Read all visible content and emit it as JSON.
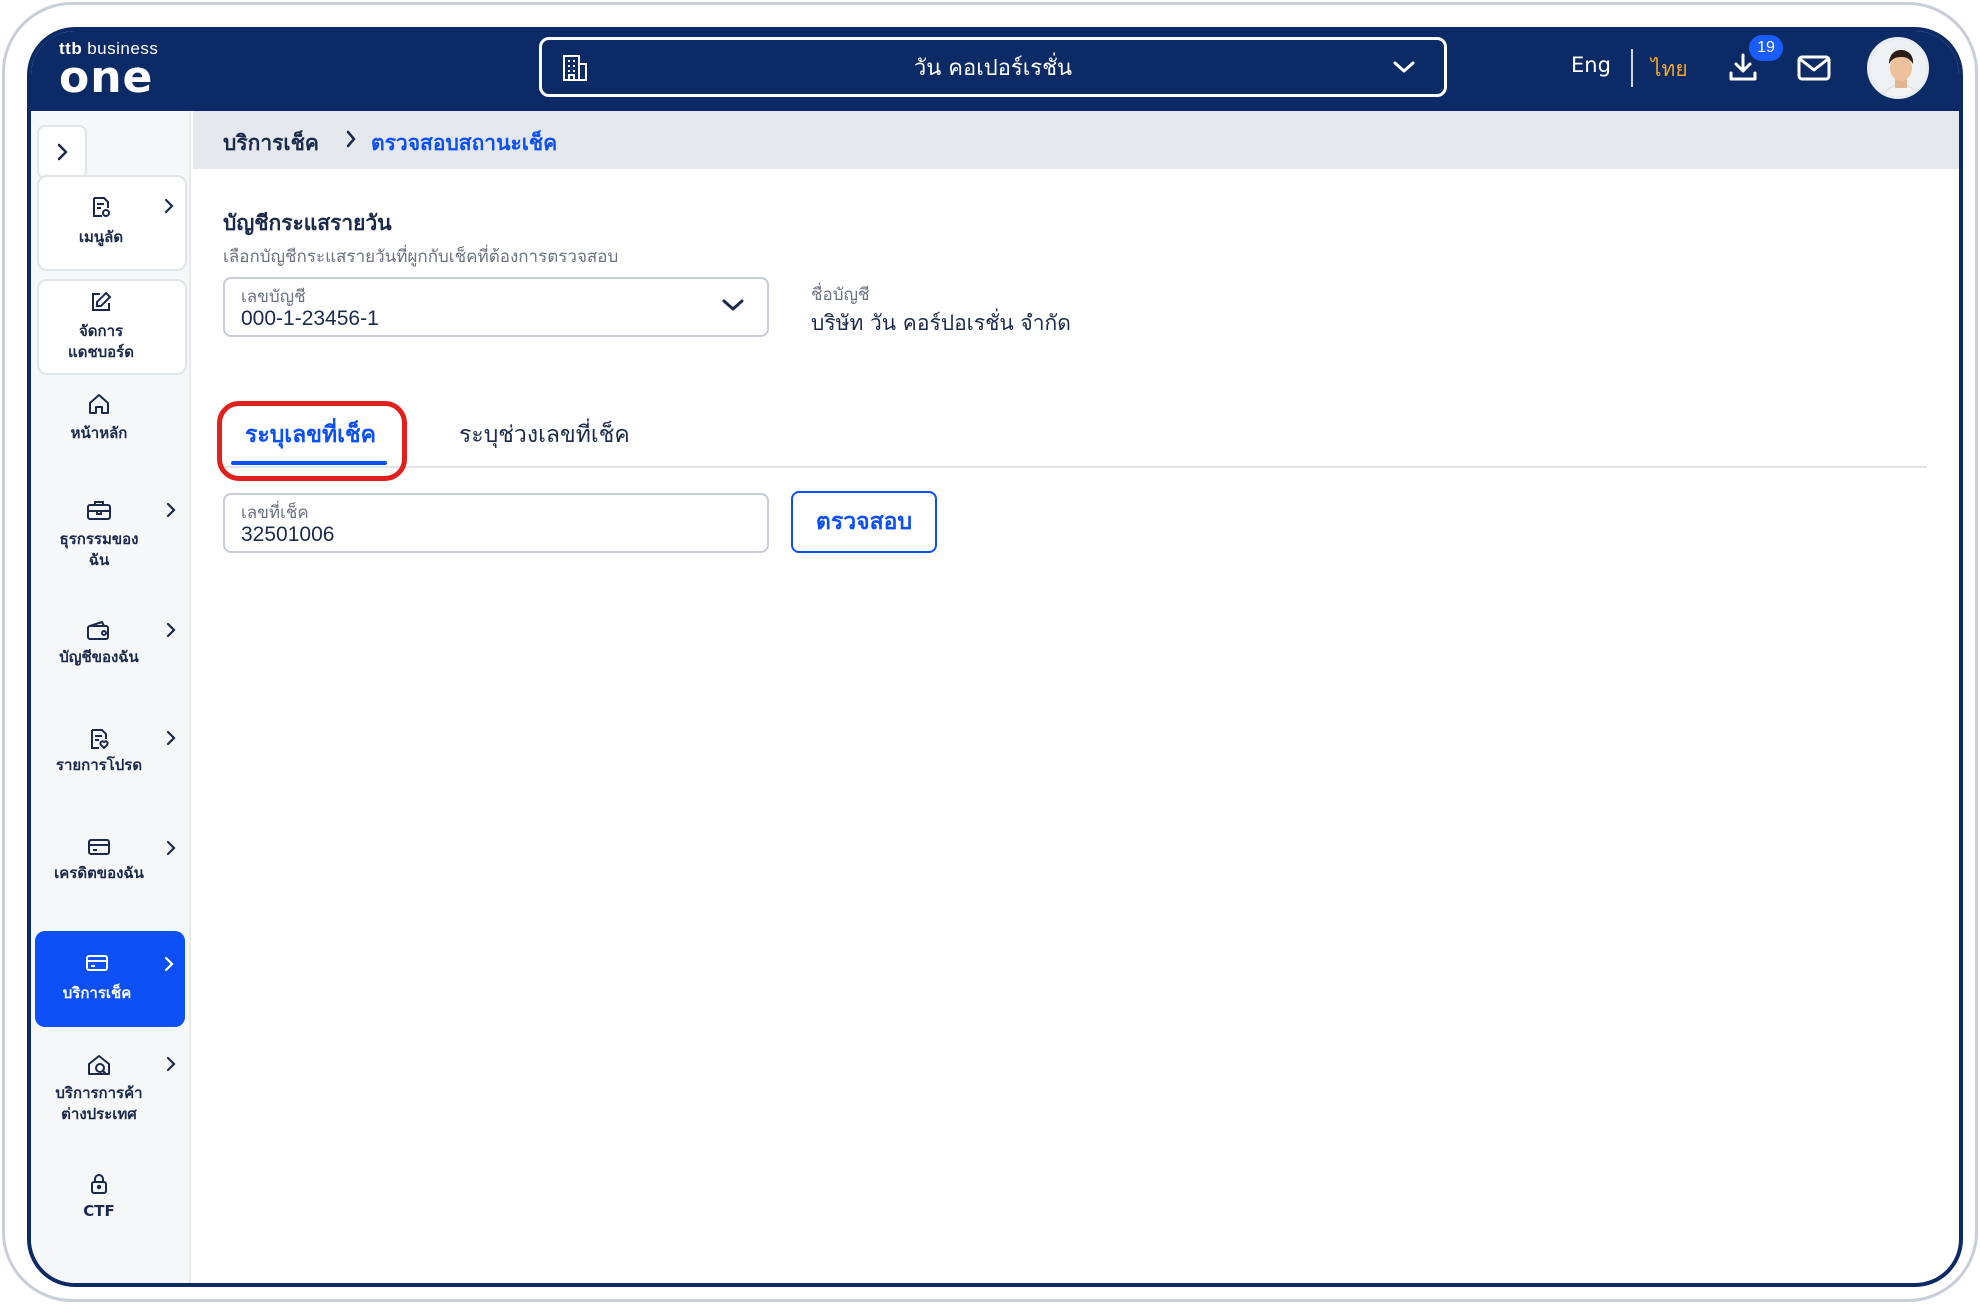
{
  "header": {
    "logo_brand": "ttb",
    "logo_suffix": "business",
    "logo_main": "one",
    "company": "วัน คอเปอร์เรชั่น",
    "lang_en": "Eng",
    "lang_th": "ไทย",
    "download_badge": "19"
  },
  "sidebar": {
    "items": [
      {
        "label": "เมนูลัด"
      },
      {
        "label": "จัดการ แดชบอร์ด"
      },
      {
        "label": "หน้าหลัก"
      },
      {
        "label": "ธุรกรรมของ ฉัน"
      },
      {
        "label": "บัญชีของฉัน"
      },
      {
        "label": "รายการโปรด"
      },
      {
        "label": "เครดิตของฉัน"
      },
      {
        "label": "บริการเช็ค"
      },
      {
        "label": "บริการการค้า ต่างประเทศ"
      },
      {
        "label": "CTF"
      }
    ]
  },
  "breadcrumb": {
    "parent": "บริการเช็ค",
    "current": "ตรวจสอบสถานะเช็ค"
  },
  "form": {
    "section_title": "บัญชีกระแสรายวัน",
    "section_subtitle": "เลือกบัญชีกระแสรายวันที่ผูกกับเช็คที่ต้องการตรวจสอบ",
    "account_label": "เลขบัญชี",
    "account_value": "000-1-23456-1",
    "account_name_label": "ชื่อบัญชี",
    "account_name_value": "บริษัท วัน คอร์ปอเรชั่น จำกัด",
    "tabs": [
      {
        "label": "ระบุเลขที่เช็ค",
        "active": true
      },
      {
        "label": "ระบุช่วงเลขที่เช็ค",
        "active": false
      }
    ],
    "cheque_label": "เลขที่เช็ค",
    "cheque_value": "32501006",
    "check_button": "ตรวจสอบ"
  },
  "colors": {
    "navy": "#0c2a66",
    "accent_blue": "#0b4ff5",
    "lang_active": "#f5a623",
    "highlight_red": "#e0201d"
  }
}
